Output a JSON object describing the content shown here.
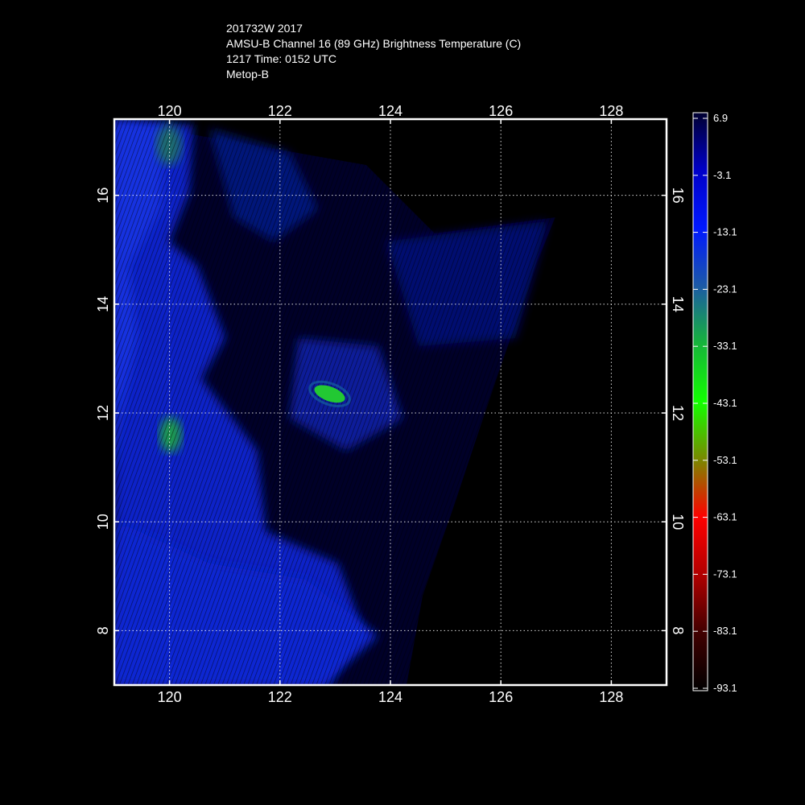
{
  "header": {
    "storm_id": "201732W 2017",
    "product": "AMSU-B Channel 16 (89 GHz) Brightness Temperature (C)",
    "time": "1217 Time: 0152 UTC",
    "satellite": "Metop-B"
  },
  "map": {
    "lon_range": [
      119,
      129
    ],
    "lat_range": [
      7,
      17.4
    ],
    "lon_ticks": [
      "120",
      "122",
      "124",
      "126",
      "128"
    ],
    "lat_ticks": [
      "8",
      "10",
      "12",
      "14",
      "16"
    ],
    "gridlines": true,
    "brightest_feature": {
      "lon": 122.9,
      "lat": 12.35,
      "color": "#22c833"
    }
  },
  "colorbar": {
    "labels": [
      "6.9",
      "-3.1",
      "-13.1",
      "-23.1",
      "-33.1",
      "-43.1",
      "-53.1",
      "-63.1",
      "-73.1",
      "-83.1",
      "-93.1"
    ],
    "colors": [
      "#000030",
      "#0000c0",
      "#0010ff",
      "#1a5aa8",
      "#17b53a",
      "#12ff00",
      "#7f8a00",
      "#ff0000",
      "#c00000",
      "#500000",
      "#000000"
    ]
  }
}
